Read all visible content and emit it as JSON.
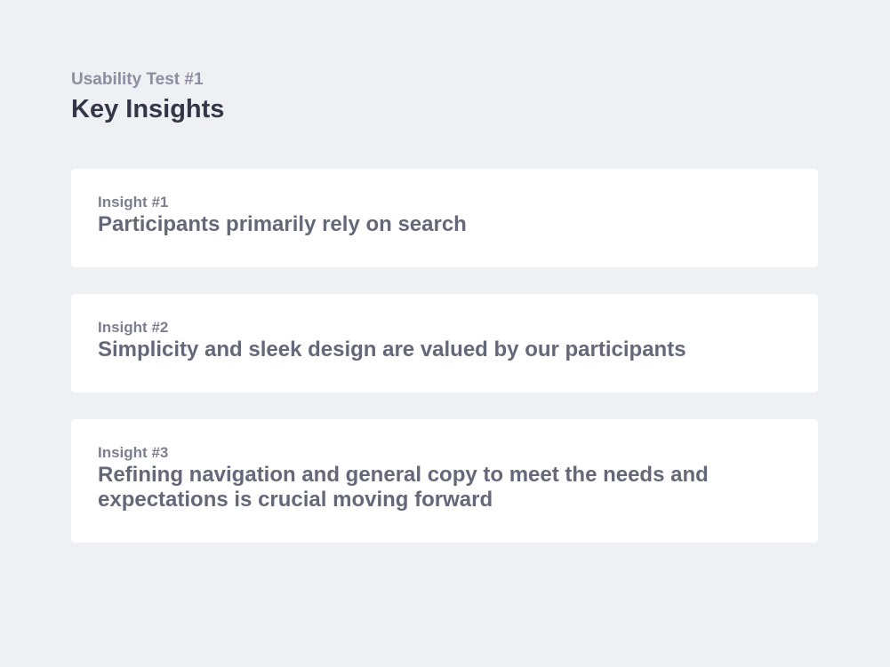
{
  "header": {
    "eyebrow": "Usability Test #1",
    "title": "Key Insights"
  },
  "insights": [
    {
      "label": "Insight #1",
      "text": "Participants primarily rely on search"
    },
    {
      "label": "Insight #2",
      "text": "Simplicity and sleek design are valued by our participants"
    },
    {
      "label": "Insight #3",
      "text": "Refining navigation and general copy to meet the needs and expectations is crucial moving forward"
    }
  ],
  "colors": {
    "background": "#eff0f3",
    "card": "#ffffff",
    "title": "#333647",
    "eyebrow": "#8b8f9f",
    "card_label": "#7b7f8f",
    "card_text": "#646878"
  }
}
